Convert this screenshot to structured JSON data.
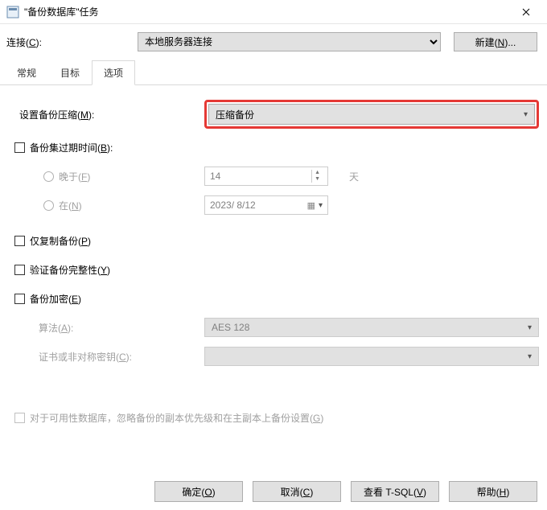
{
  "title": "\"备份数据库\"任务",
  "connection": {
    "label_pre": "连接(",
    "label_hot": "C",
    "label_post": "):",
    "value": "本地服务器连接",
    "new_pre": "新建(",
    "new_hot": "N",
    "new_post": ")..."
  },
  "tabs": {
    "general": "常规",
    "target": "目标",
    "options": "选项"
  },
  "options": {
    "compress_lbl_pre": "设置备份压缩(",
    "compress_lbl_hot": "M",
    "compress_lbl_post": "):",
    "compress_val": "压缩备份",
    "expire_lbl_pre": "备份集过期时间(",
    "expire_lbl_hot": "B",
    "expire_lbl_post": "):",
    "after_pre": "晚于(",
    "after_hot": "F",
    "after_post": ")",
    "after_val": "14",
    "days": "天",
    "on_pre": "在(",
    "on_hot": "N",
    "on_post": ")",
    "on_val": "2023/ 8/12",
    "copyonly_pre": "仅复制备份(",
    "copyonly_hot": "P",
    "copyonly_post": ")",
    "verify_pre": "验证备份完整性(",
    "verify_hot": "Y",
    "verify_post": ")",
    "encrypt_pre": "备份加密(",
    "encrypt_hot": "E",
    "encrypt_post": ")",
    "algo_pre": "算法(",
    "algo_hot": "A",
    "algo_post": "):",
    "algo_val": "AES 128",
    "cert_pre": "证书或非对称密钥(",
    "cert_hot": "C",
    "cert_post": "):",
    "avail_pre": "对于可用性数据库，忽略备份的副本优先级和在主副本上备份设置(",
    "avail_hot": "G",
    "avail_post": ")"
  },
  "buttons": {
    "ok_pre": "确定(",
    "ok_hot": "O",
    "ok_post": ")",
    "cancel_pre": "取消(",
    "cancel_hot": "C",
    "cancel_post": ")",
    "tsql_pre": "查看 T-SQL(",
    "tsql_hot": "V",
    "tsql_post": ")",
    "help_pre": "帮助(",
    "help_hot": "H",
    "help_post": ")"
  }
}
